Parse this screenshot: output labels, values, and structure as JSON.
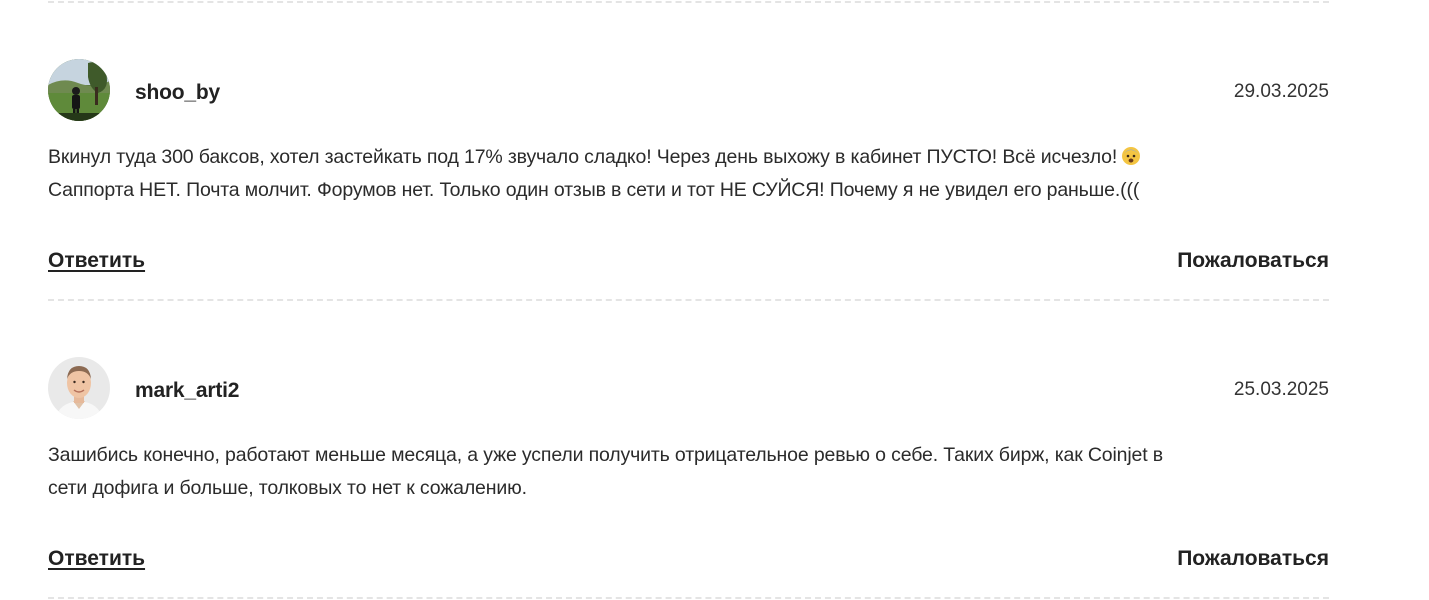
{
  "comments": [
    {
      "username": "shoo_by",
      "date": "29.03.2025",
      "text": "Вкинул туда 300 баксов, хотел застейкать под 17% звучало сладко! Через день выхожу в кабинет ПУСТО! Всё исчезло!",
      "text_line2": "Саппорта НЕТ. Почта молчит. Форумов нет. Только один отзыв в сети и тот НЕ СУЙСЯ! Почему я не увидел его раньше.(((",
      "emoji": "fearful-face-emoji",
      "reply_label": "Ответить",
      "complain_label": "Пожаловаться"
    },
    {
      "username": "mark_arti2",
      "date": "25.03.2025",
      "text": "Зашибись конечно, работают меньше месяца, а уже успели получить отрицательное ревью о себе. Таких бирж, как Coinjet в",
      "text_line2": "сети дофига и больше, толковых то нет к сожалению.",
      "reply_label": "Ответить",
      "complain_label": "Пожаловаться"
    }
  ]
}
